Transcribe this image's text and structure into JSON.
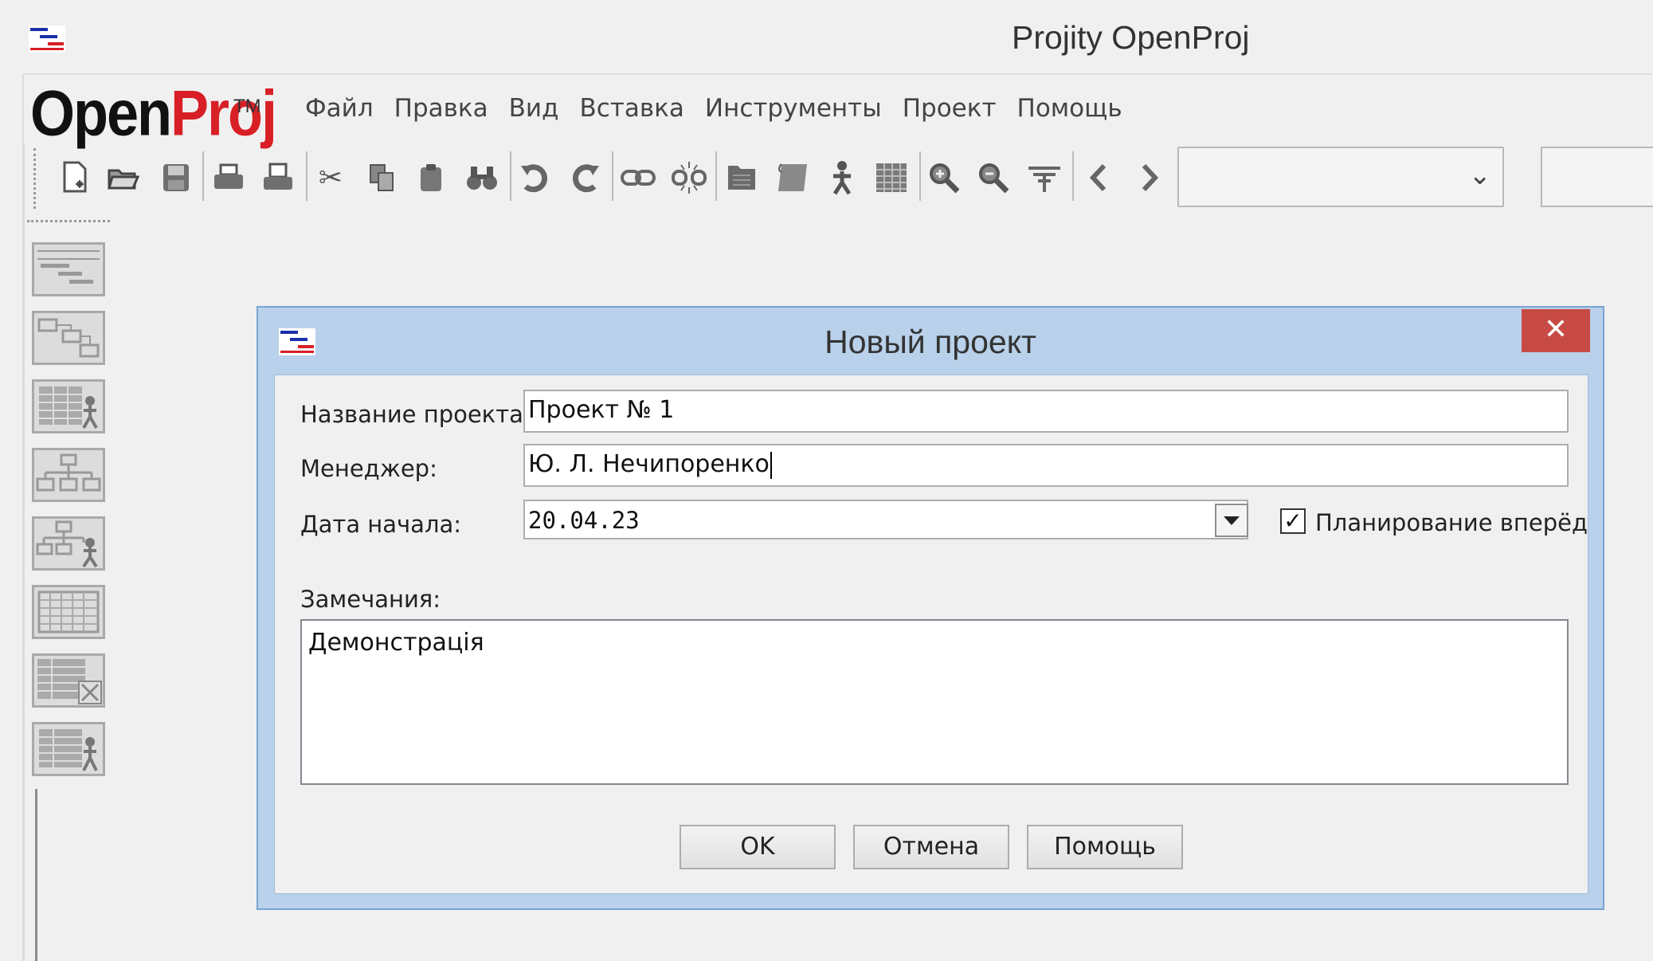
{
  "window": {
    "title": "Projity OpenProj"
  },
  "logo": {
    "part1": "Open",
    "part2": "Proj",
    "trademark": "TM"
  },
  "menu": [
    {
      "label": "Файл"
    },
    {
      "label": "Правка"
    },
    {
      "label": "Вид"
    },
    {
      "label": "Вставка"
    },
    {
      "label": "Инструменты"
    },
    {
      "label": "Проект"
    },
    {
      "label": "Помощь"
    }
  ],
  "toolbar": {
    "icons": [
      "new-project-icon",
      "open-icon",
      "save-icon",
      "print-icon",
      "print-preview-icon",
      "cut-icon",
      "copy-icon",
      "paste-icon",
      "find-icon",
      "undo-icon",
      "redo-icon",
      "link-icon",
      "unlink-icon",
      "task-info-icon",
      "notes-icon",
      "assign-resources-icon",
      "calendar-icon",
      "zoom-in-icon",
      "zoom-out-icon",
      "filter-icon",
      "scroll-left-icon",
      "scroll-right-icon"
    ],
    "view_combo_value": ""
  },
  "sidebar": {
    "views": [
      "gantt-view",
      "network-view",
      "resource-usage-view",
      "wbs-view",
      "rbs-view",
      "task-usage-view",
      "report-view",
      "resource-view"
    ]
  },
  "dialog": {
    "title": "Новый проект",
    "close_glyph": "✕",
    "project_name_label": "Название проекта:",
    "project_name_value": "Проект № 1",
    "manager_label": "Менеджер:",
    "manager_value": "Ю. Л. Нечипоренко",
    "start_date_label": "Дата начала:",
    "start_date_value": "20.04.23",
    "forward_label": "Планирование вперёд",
    "forward_checked": true,
    "notes_label": "Замечания:",
    "notes_value": "Демонстрація",
    "ok_label": "OK",
    "cancel_label": "Отмена",
    "help_label": "Помощь"
  },
  "colors": {
    "dialog_frame": "#b9d1ea",
    "close_button": "#c74a44",
    "logo_red": "#d81f26",
    "logo_black": "#111111"
  }
}
